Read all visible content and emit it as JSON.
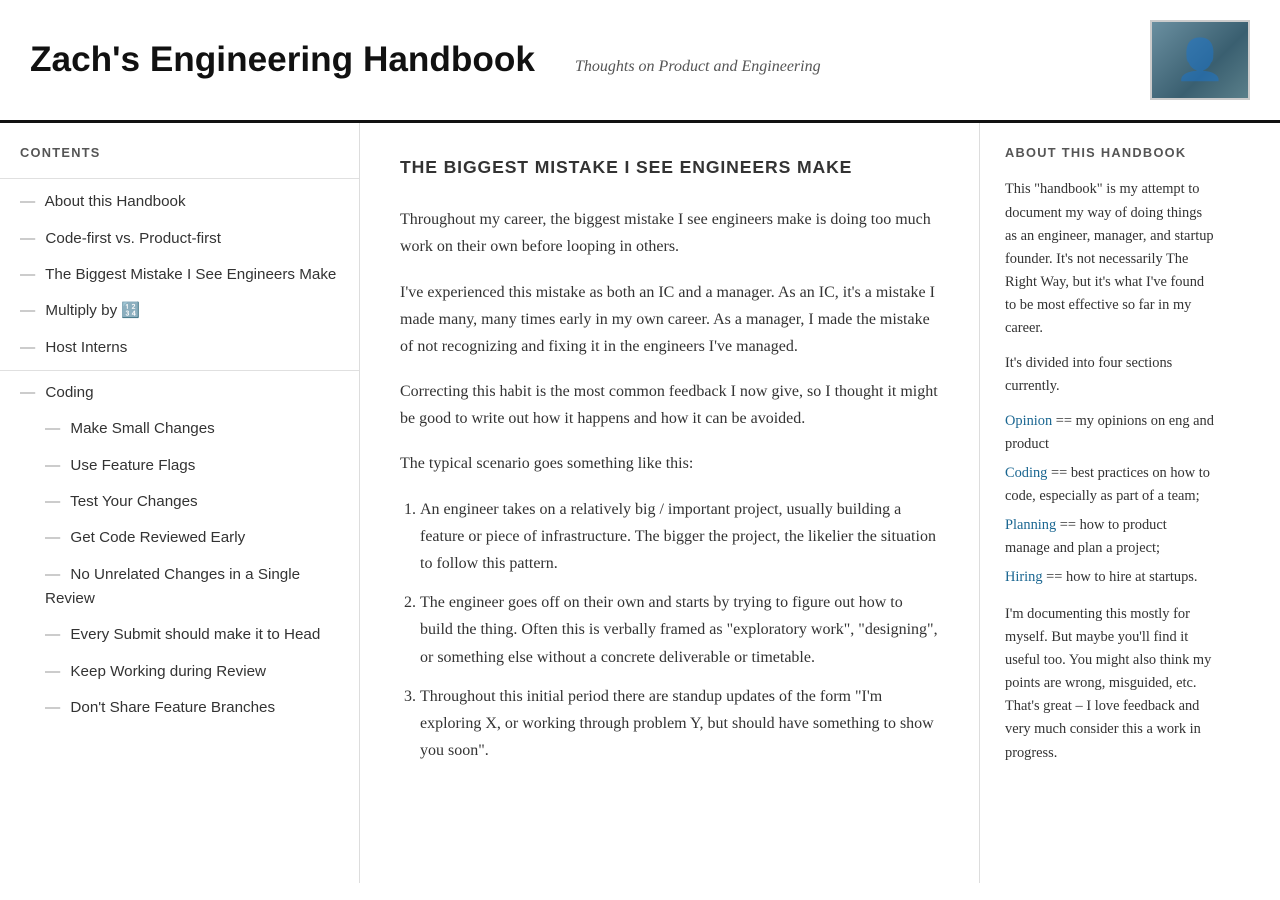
{
  "header": {
    "title": "Zach's Engineering Handbook",
    "tagline": "Thoughts on Product and Engineering"
  },
  "sidebar": {
    "contents_label": "CONTENTS",
    "items": [
      {
        "id": "about-handbook",
        "label": "About this Handbook",
        "level": "top"
      },
      {
        "id": "code-first",
        "label": "Code-first vs. Product-first",
        "level": "top"
      },
      {
        "id": "biggest-mistake",
        "label": "The Biggest Mistake I See Engineers Make",
        "level": "top"
      },
      {
        "id": "multiply",
        "label": "Multiply by 🔢",
        "level": "top"
      },
      {
        "id": "host-interns",
        "label": "Host Interns",
        "level": "top"
      },
      {
        "id": "coding",
        "label": "Coding",
        "level": "top"
      },
      {
        "id": "make-small-changes",
        "label": "Make Small Changes",
        "level": "sub"
      },
      {
        "id": "use-feature-flags",
        "label": "Use Feature Flags",
        "level": "sub"
      },
      {
        "id": "test-changes",
        "label": "Test Your Changes",
        "level": "sub"
      },
      {
        "id": "get-code-reviewed",
        "label": "Get Code Reviewed Early",
        "level": "sub"
      },
      {
        "id": "no-unrelated-changes",
        "label": "No Unrelated Changes in a Single Review",
        "level": "sub"
      },
      {
        "id": "every-submit",
        "label": "Every Submit should make it to Head",
        "level": "sub"
      },
      {
        "id": "keep-working",
        "label": "Keep Working during Review",
        "level": "sub"
      },
      {
        "id": "dont-share",
        "label": "Don't Share Feature Branches",
        "level": "sub"
      }
    ]
  },
  "article": {
    "title": "THE BIGGEST MISTAKE I SEE ENGINEERS MAKE",
    "paragraphs": [
      "Throughout my career, the biggest mistake I see engineers make is doing too much work on their own before looping in others.",
      "I've experienced this mistake as both an IC and a manager. As an IC, it's a mistake I made many, many times early in my own career. As a manager, I made the mistake of not recognizing and fixing it in the engineers I've managed.",
      "Correcting this habit is the most common feedback I now give, so I thought it might be good to write out how it happens and how it can be avoided.",
      "The typical scenario goes something like this:"
    ],
    "list_items": [
      "An engineer takes on a relatively big / important project, usually building a feature or piece of infrastructure.  The bigger the project, the likelier the situation to follow this pattern.",
      "The engineer goes off on their own and starts by trying to figure out how to build the thing.  Often this is verbally framed as \"exploratory work\", \"designing\", or something else without a concrete deliverable or timetable.",
      "Throughout this initial period there are standup updates of the form \"I'm exploring X, or working through problem Y, but should have something to show you soon\"."
    ]
  },
  "about": {
    "label": "ABOUT THIS HANDBOOK",
    "description1": "This \"handbook\" is my attempt to document my way of doing things as an engineer, manager, and startup founder.  It's not necessarily The Right Way, but it's what I've found to be most effective so far in my career.",
    "description2": "It's divided into four sections currently.",
    "sections": [
      {
        "id": "opinion",
        "link_text": "Opinion",
        "description": " == my opinions on eng and product"
      },
      {
        "id": "coding",
        "link_text": "Coding",
        "description": " == best practices on how to code, especially as part of a team;"
      },
      {
        "id": "planning",
        "link_text": "Planning",
        "description": " == how to product manage and plan a project;"
      },
      {
        "id": "hiring",
        "link_text": "Hiring",
        "description": " == how to hire at startups."
      }
    ],
    "description3": "I'm documenting this mostly for myself.  But maybe you'll find it useful too.  You might also think my points are wrong, misguided, etc.  That's great – I love feedback and very much consider this a work in progress."
  }
}
